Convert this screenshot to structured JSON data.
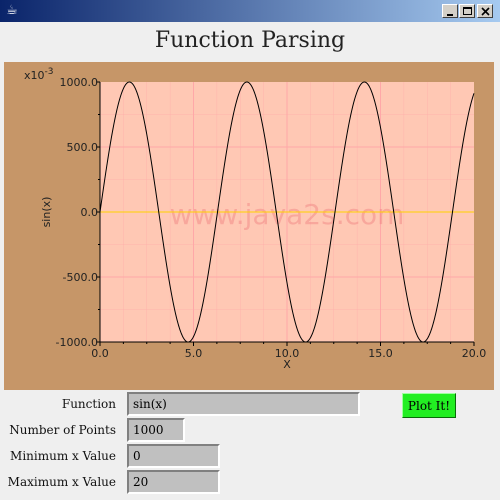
{
  "window": {
    "app_icon": "java-cup-icon",
    "controls": [
      "minimize-icon",
      "maximize-icon",
      "close-icon"
    ]
  },
  "page": {
    "title": "Function Parsing"
  },
  "colors": {
    "titlebar_left": "#0a246a",
    "titlebar_right": "#a6caf0",
    "plot_panel": "#c69668",
    "plot_area": "#ffc8b4",
    "grid": "#ffa8a8",
    "curve": "#000000",
    "zero_line": "#ffd200",
    "watermark": "#f08080",
    "button": "#22ee22"
  },
  "chart_data": {
    "type": "line",
    "function": "sin(x)",
    "points": 1000,
    "x_min": 0,
    "x_max": 20,
    "xlabel": "X",
    "ylabel": "sin(x)",
    "y_multiplier": "x10-3",
    "xlim": [
      0,
      20
    ],
    "ylim": [
      -1000,
      1000
    ],
    "x_ticks": [
      "0.0",
      "5.0",
      "10.0",
      "15.0",
      "20.0"
    ],
    "y_ticks": [
      "1000.0",
      "500.0",
      "0.0",
      "-500.0",
      "-1000.0"
    ],
    "watermark": "www.java2s.com",
    "grid": true
  },
  "form": {
    "function_label": "Function",
    "function_value": "sin(x)",
    "points_label": "Number of Points",
    "points_value": "1000",
    "min_label": "Minimum x Value",
    "min_value": "0",
    "max_label": "Maximum x Value",
    "max_value": "20",
    "plot_button": "Plot It!"
  }
}
